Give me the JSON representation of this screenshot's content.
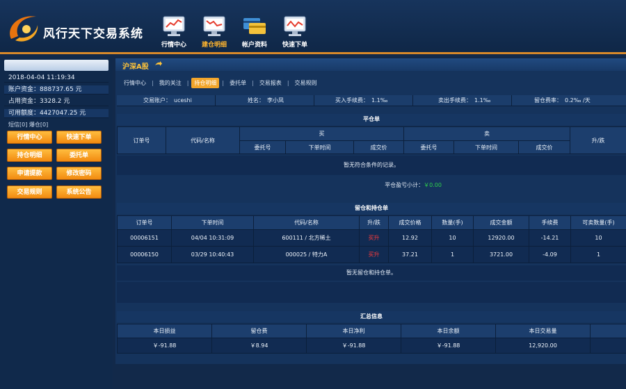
{
  "header": {
    "app_title": "风行天下交易系统",
    "nav": [
      {
        "label": "行情中心",
        "icon": "monitor-chart-icon",
        "active": false
      },
      {
        "label": "建仓明细",
        "icon": "monitor-chart-icon",
        "active": true
      },
      {
        "label": "帐户资料",
        "icon": "credit-cards-icon",
        "active": false
      },
      {
        "label": "快速下单",
        "icon": "monitor-chart-icon",
        "active": false
      }
    ]
  },
  "sidebar": {
    "datetime": "2018-04-04 11:19:34",
    "account_funds_label": "账户资金：",
    "account_funds_value": "888737.65 元",
    "occupied_funds_label": "占用资金：",
    "occupied_funds_value": "3328.2 元",
    "available_label": "可用额度：",
    "available_value": "4427047.25 元",
    "messages": "短信[0] 爆仓[0]",
    "buttons": [
      "行情中心",
      "快速下单",
      "持仓明细",
      "委托单",
      "申请提款",
      "修改密码",
      "交易规则",
      "系统公告"
    ]
  },
  "main": {
    "market_title": "沪深A股",
    "tabs": [
      {
        "label": "行情中心",
        "active": false
      },
      {
        "label": "我的关注",
        "active": false
      },
      {
        "label": "持仓明细",
        "active": true
      },
      {
        "label": "委托单",
        "active": false
      },
      {
        "label": "交易报表",
        "active": false
      },
      {
        "label": "交易规则",
        "active": false
      }
    ],
    "account_bar": {
      "account_label": "交易账户：",
      "account_value": "uceshi",
      "name_label": "姓名：",
      "name_value": "李小凤",
      "buy_fee_label": "买入手续费：",
      "buy_fee_value": "1.1‰",
      "sell_fee_label": "卖出手续费：",
      "sell_fee_value": "1.1‰",
      "overnight_label": "留仓费率：",
      "overnight_value": "0.2‰ /天"
    },
    "close_section": {
      "title": "平仓单",
      "headers": {
        "order_no": "订单号",
        "code_name": "代码/名称",
        "buy": "买",
        "sell": "卖",
        "direction": "升/跌",
        "entrust_no": "委托号",
        "order_time": "下单时间",
        "deal_price": "成交价"
      },
      "empty_text": "暂无符合条件的记录。",
      "subtotal_label": "平仓盈亏小计：",
      "subtotal_value": "￥0.00"
    },
    "hold_section": {
      "title": "留仓和持仓单",
      "headers": [
        "订单号",
        "下单时间",
        "代码/名称",
        "升/跌",
        "成交价格",
        "数量(手)",
        "成交金额",
        "手续费",
        "可卖数量(手)"
      ],
      "rows": [
        [
          "00006151",
          "04/04 10:31:09",
          "600111 / 北方稀土",
          "买升",
          "12.92",
          "10",
          "12920.00",
          "-14.21",
          "10"
        ],
        [
          "00006150",
          "03/29 10:40:43",
          "000025 / 特力A",
          "买升",
          "37.21",
          "1",
          "3721.00",
          "-4.09",
          "1"
        ]
      ],
      "empty_text": "暂无留仓和持仓单。"
    },
    "summary_section": {
      "title": "汇总信息",
      "headers": [
        "本日损益",
        "留仓费",
        "本日净利",
        "本日余额",
        "本日交易量"
      ],
      "values": [
        "￥-91.88",
        "￥8.94",
        "￥-91.88",
        "￥-91.88",
        "12,920.00"
      ]
    }
  },
  "colors": {
    "accent_orange": "#f2a52b",
    "header_border": "#d7892a",
    "up_red": "#ff3b3b",
    "profit_green": "#2ed14b"
  }
}
